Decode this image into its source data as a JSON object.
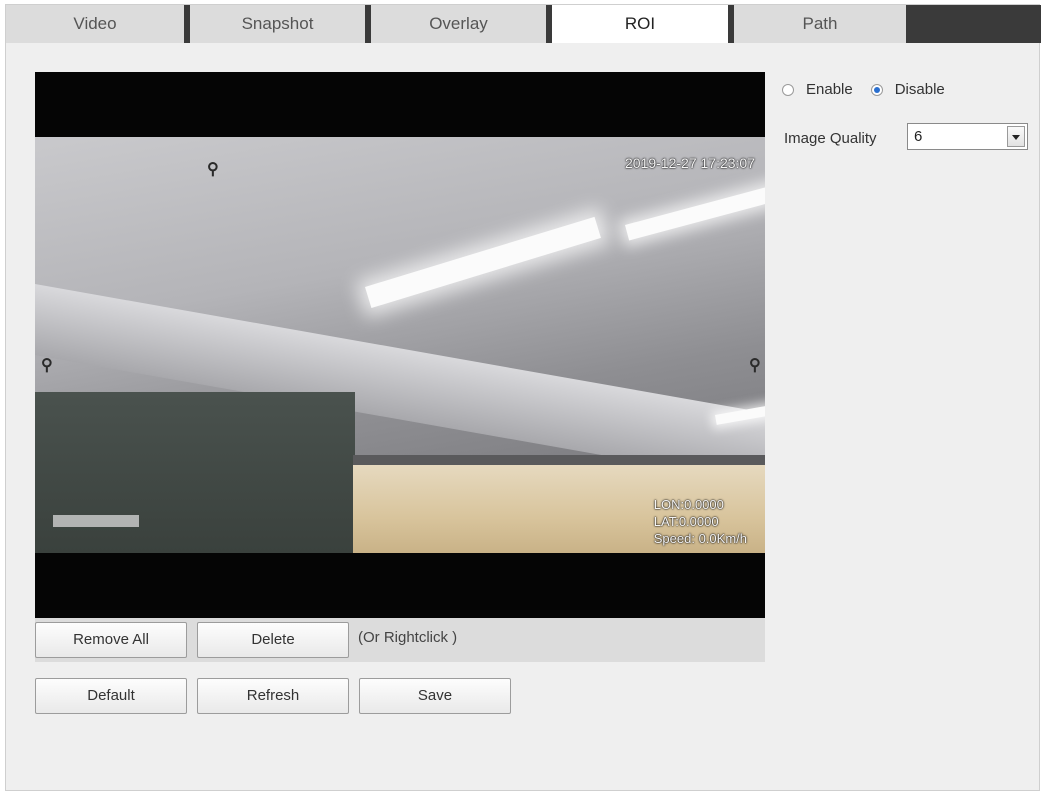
{
  "tabs": [
    {
      "label": "Video"
    },
    {
      "label": "Snapshot"
    },
    {
      "label": "Overlay"
    },
    {
      "label": "ROI",
      "active": true
    },
    {
      "label": "Path"
    }
  ],
  "preview": {
    "timestamp": "2019-12-27 17:23:07",
    "gps_lon": "LON:0.0000",
    "gps_lat": "LAT:0.0000",
    "speed": "Speed: 0.0Km/h"
  },
  "roi_buttons": {
    "remove_all": "Remove All",
    "delete": "Delete",
    "hint": "(Or Rightclick )"
  },
  "actions": {
    "default": "Default",
    "refresh": "Refresh",
    "save": "Save"
  },
  "settings": {
    "enable_label": "Enable",
    "disable_label": "Disable",
    "selected": "Disable",
    "image_quality_label": "Image Quality",
    "image_quality_value": "6"
  },
  "colors": {
    "tab_active": "#ffffff",
    "tab_inactive": "#dcdcdc",
    "tab_separator": "#3a3a3a",
    "radio_selected": "#2a6fcf"
  }
}
